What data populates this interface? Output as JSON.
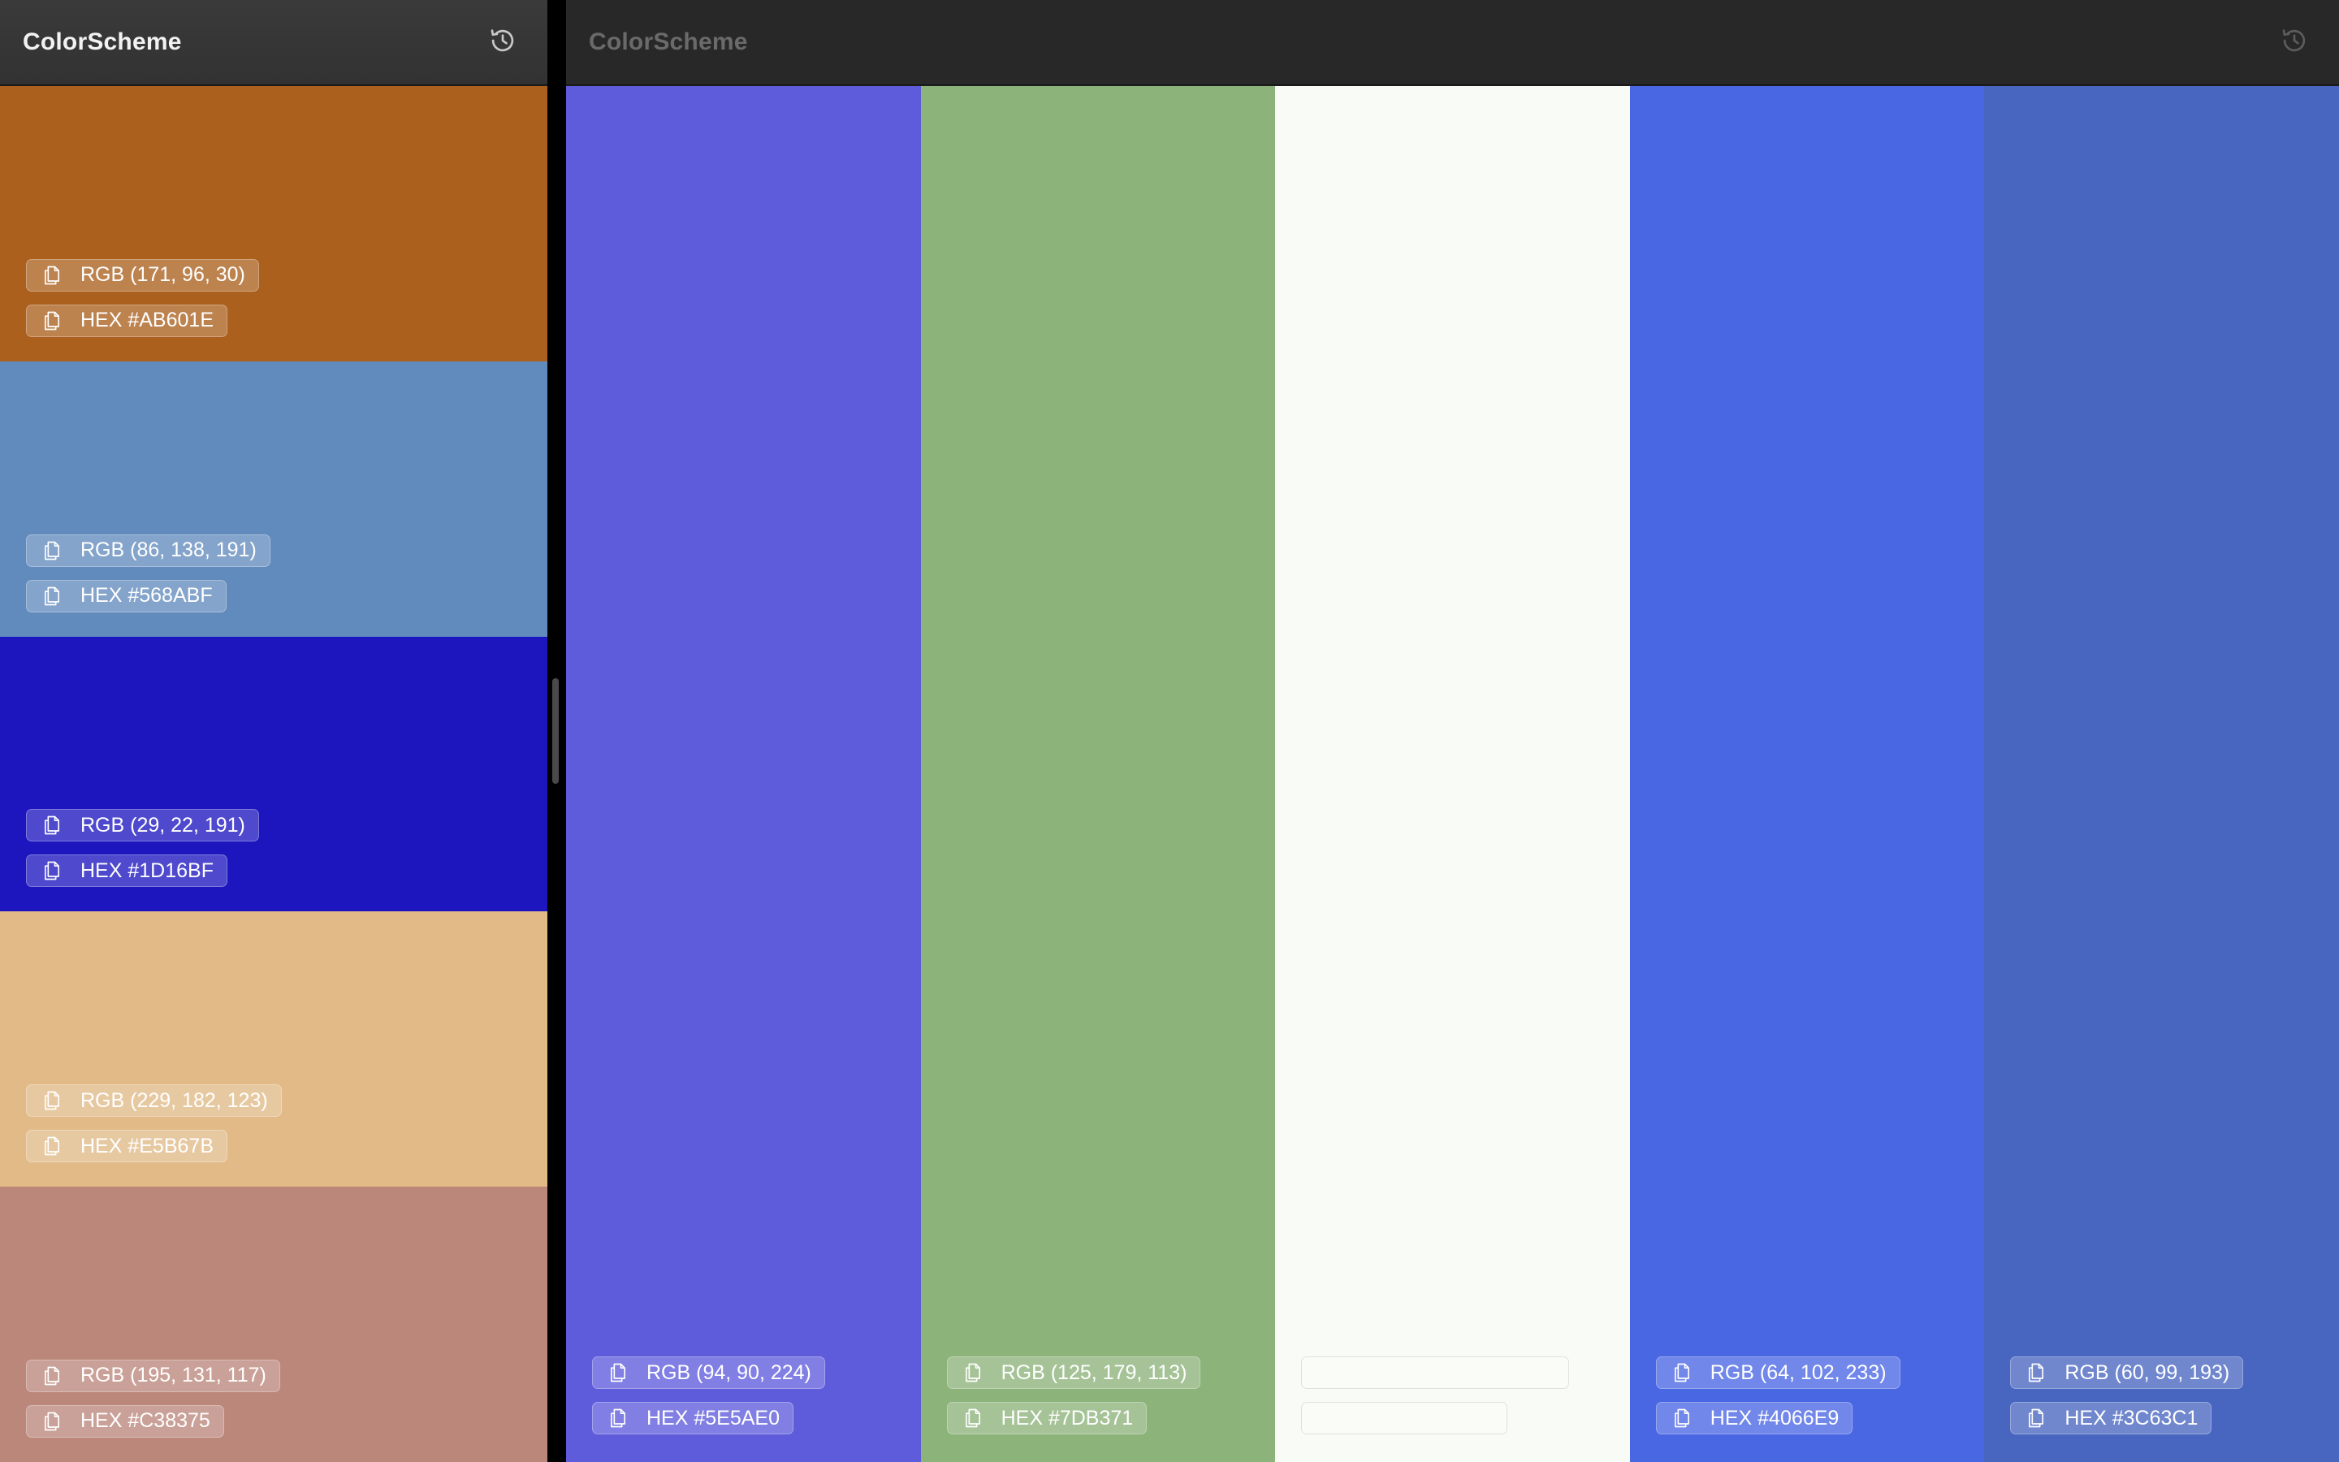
{
  "left_window": {
    "title": "ColorScheme",
    "history_icon": "history-icon",
    "swatches": [
      {
        "color": "#AB601E",
        "rgb": "RGB (171, 96, 30)",
        "hex": "HEX #AB601E"
      },
      {
        "color": "#628BBD",
        "rgb": "RGB (86, 138, 191)",
        "hex": "HEX #568ABF"
      },
      {
        "color": "#1D16BF",
        "rgb": "RGB (29, 22, 191)",
        "hex": "HEX #1D16BF"
      },
      {
        "color": "#E1BA87",
        "rgb": "RGB (229, 182, 123)",
        "hex": "HEX #E5B67B"
      },
      {
        "color": "#BB877B",
        "rgb": "RGB (195, 131, 117)",
        "hex": "HEX #C38375"
      }
    ]
  },
  "right_window": {
    "title": "ColorScheme",
    "history_icon": "history-icon",
    "swatches": [
      {
        "color": "#5E5CDB",
        "rgb": "RGB (94, 90, 224)",
        "hex": "HEX #5E5AE0"
      },
      {
        "color": "#8CB37A",
        "rgb": "RGB (125, 179, 113)",
        "hex": "HEX #7DB371"
      },
      {
        "color": "#F9FCF6",
        "rgb": "",
        "hex": "",
        "light": true
      },
      {
        "color": "#4966E3",
        "rgb": "RGB (64, 102, 233)",
        "hex": "HEX #4066E9"
      },
      {
        "color": "#4866C0",
        "rgb": "RGB (60, 99, 193)",
        "hex": "HEX #3C63C1"
      }
    ]
  },
  "icons": {
    "copy": "copy-icon",
    "history": "history-icon"
  }
}
